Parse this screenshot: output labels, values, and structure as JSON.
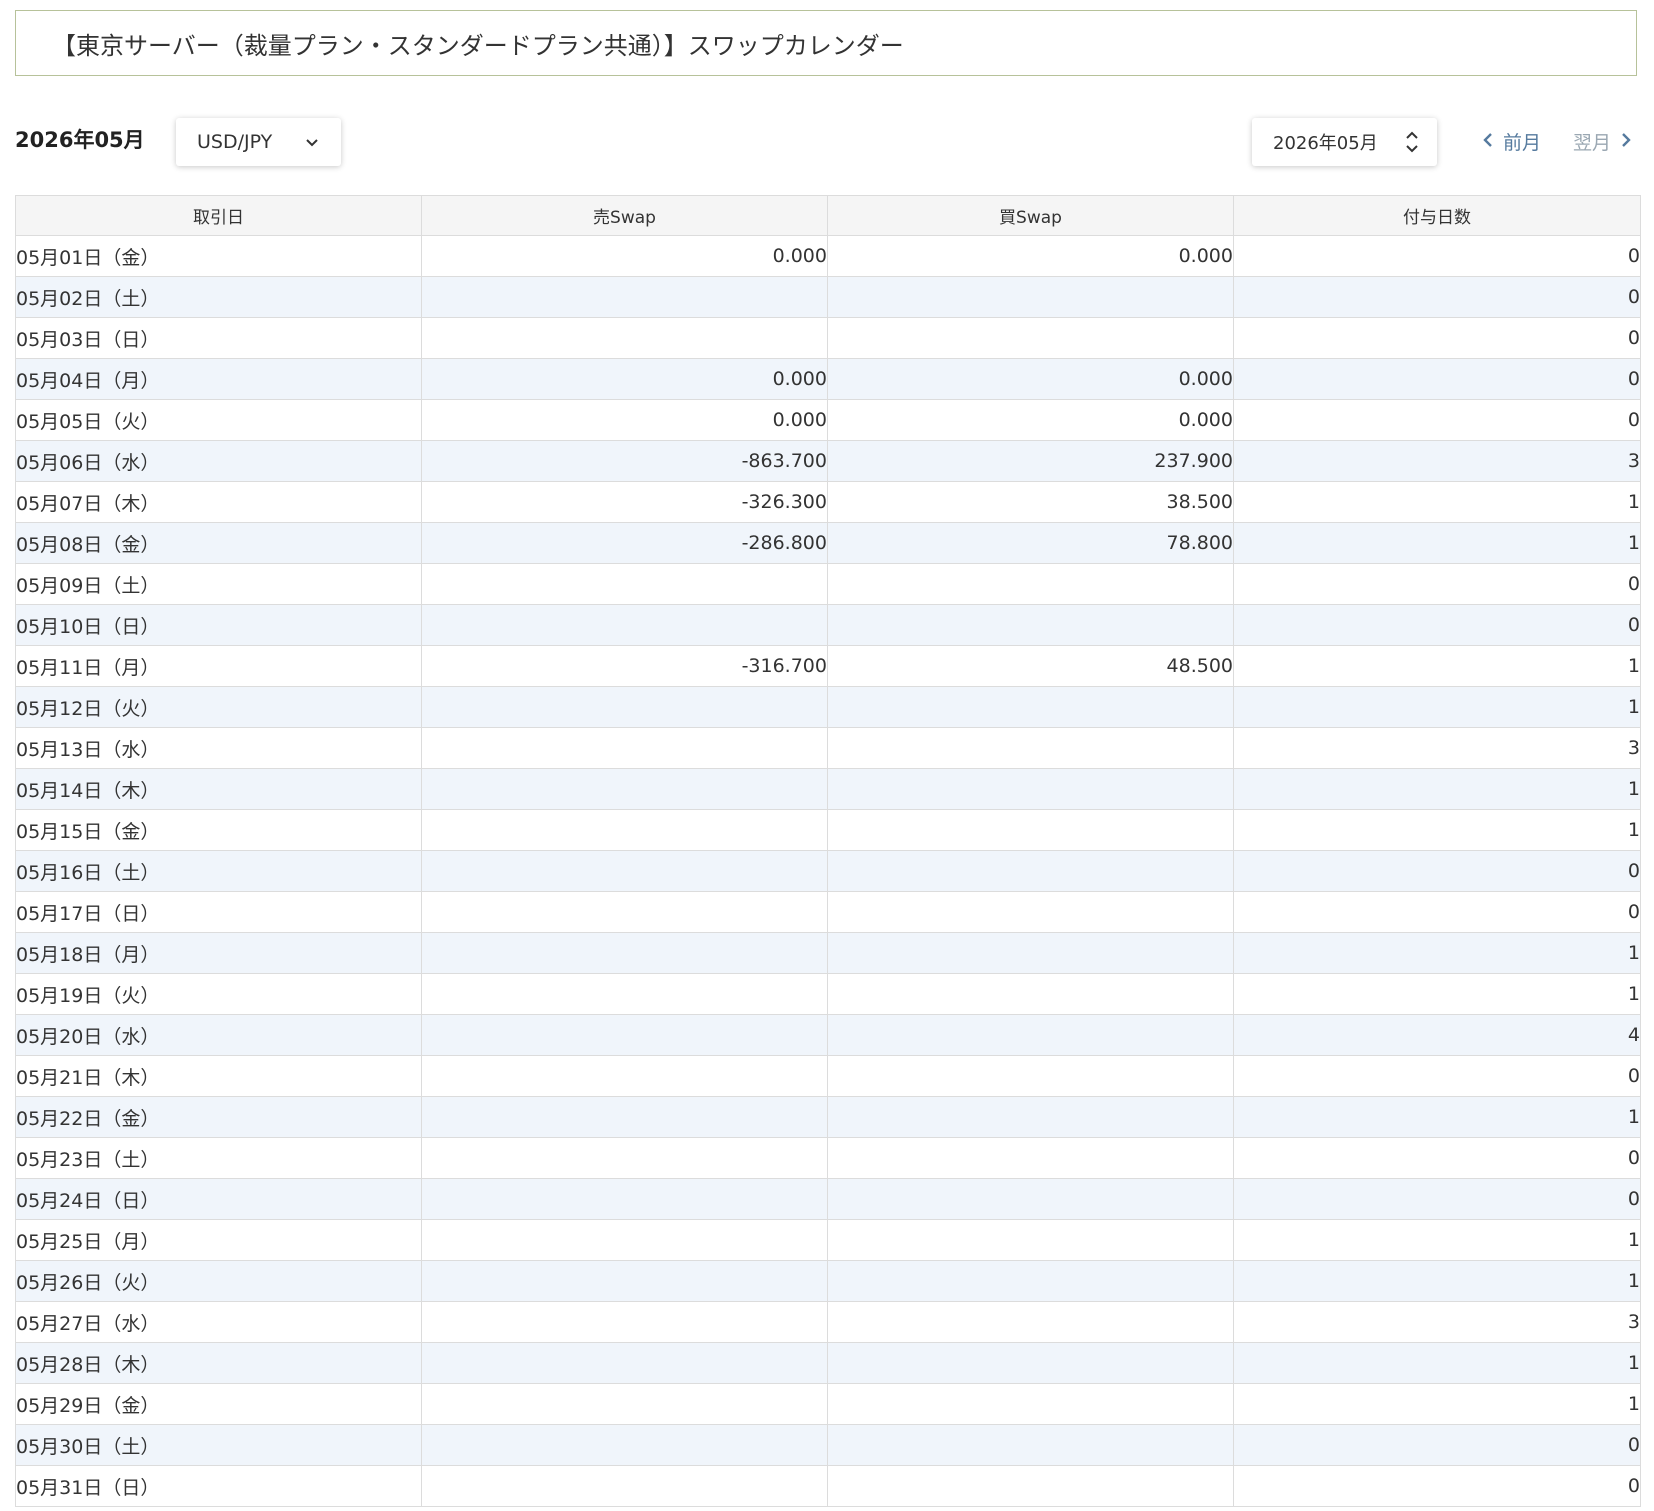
{
  "header": {
    "title": "【東京サーバー（裁量プラン・スタンダードプラン共通）】スワップカレンダー",
    "month_heading": "2026年05月"
  },
  "controls": {
    "pair_select_value": "USD/JPY",
    "month_select_value": "2026年05月",
    "prev_label": "前月",
    "next_label": "翌月"
  },
  "icons": {
    "pair_select": "chevron-down-icon",
    "month_select": "stepper-updown-icon",
    "prev": "chevron-left-icon",
    "next": "chevron-right-icon"
  },
  "colors": {
    "title_border": "#b7c29a",
    "row_stripe": "#f0f5fb",
    "header_bg": "#f5f5f5",
    "link_active": "#557a9e",
    "link_inactive": "#9aa7b2"
  },
  "table": {
    "columns": [
      "取引日",
      "売Swap",
      "買Swap",
      "付与日数"
    ],
    "rows": [
      {
        "date": "05月01日（金）",
        "sell": "0.000",
        "buy": "0.000",
        "days": "0"
      },
      {
        "date": "05月02日（土）",
        "sell": "",
        "buy": "",
        "days": "0"
      },
      {
        "date": "05月03日（日）",
        "sell": "",
        "buy": "",
        "days": "0"
      },
      {
        "date": "05月04日（月）",
        "sell": "0.000",
        "buy": "0.000",
        "days": "0"
      },
      {
        "date": "05月05日（火）",
        "sell": "0.000",
        "buy": "0.000",
        "days": "0"
      },
      {
        "date": "05月06日（水）",
        "sell": "-863.700",
        "buy": "237.900",
        "days": "3"
      },
      {
        "date": "05月07日（木）",
        "sell": "-326.300",
        "buy": "38.500",
        "days": "1"
      },
      {
        "date": "05月08日（金）",
        "sell": "-286.800",
        "buy": "78.800",
        "days": "1"
      },
      {
        "date": "05月09日（土）",
        "sell": "",
        "buy": "",
        "days": "0"
      },
      {
        "date": "05月10日（日）",
        "sell": "",
        "buy": "",
        "days": "0"
      },
      {
        "date": "05月11日（月）",
        "sell": "-316.700",
        "buy": "48.500",
        "days": "1"
      },
      {
        "date": "05月12日（火）",
        "sell": "",
        "buy": "",
        "days": "1"
      },
      {
        "date": "05月13日（水）",
        "sell": "",
        "buy": "",
        "days": "3"
      },
      {
        "date": "05月14日（木）",
        "sell": "",
        "buy": "",
        "days": "1"
      },
      {
        "date": "05月15日（金）",
        "sell": "",
        "buy": "",
        "days": "1"
      },
      {
        "date": "05月16日（土）",
        "sell": "",
        "buy": "",
        "days": "0"
      },
      {
        "date": "05月17日（日）",
        "sell": "",
        "buy": "",
        "days": "0"
      },
      {
        "date": "05月18日（月）",
        "sell": "",
        "buy": "",
        "days": "1"
      },
      {
        "date": "05月19日（火）",
        "sell": "",
        "buy": "",
        "days": "1"
      },
      {
        "date": "05月20日（水）",
        "sell": "",
        "buy": "",
        "days": "4"
      },
      {
        "date": "05月21日（木）",
        "sell": "",
        "buy": "",
        "days": "0"
      },
      {
        "date": "05月22日（金）",
        "sell": "",
        "buy": "",
        "days": "1"
      },
      {
        "date": "05月23日（土）",
        "sell": "",
        "buy": "",
        "days": "0"
      },
      {
        "date": "05月24日（日）",
        "sell": "",
        "buy": "",
        "days": "0"
      },
      {
        "date": "05月25日（月）",
        "sell": "",
        "buy": "",
        "days": "1"
      },
      {
        "date": "05月26日（火）",
        "sell": "",
        "buy": "",
        "days": "1"
      },
      {
        "date": "05月27日（水）",
        "sell": "",
        "buy": "",
        "days": "3"
      },
      {
        "date": "05月28日（木）",
        "sell": "",
        "buy": "",
        "days": "1"
      },
      {
        "date": "05月29日（金）",
        "sell": "",
        "buy": "",
        "days": "1"
      },
      {
        "date": "05月30日（土）",
        "sell": "",
        "buy": "",
        "days": "0"
      },
      {
        "date": "05月31日（日）",
        "sell": "",
        "buy": "",
        "days": "0"
      }
    ]
  }
}
